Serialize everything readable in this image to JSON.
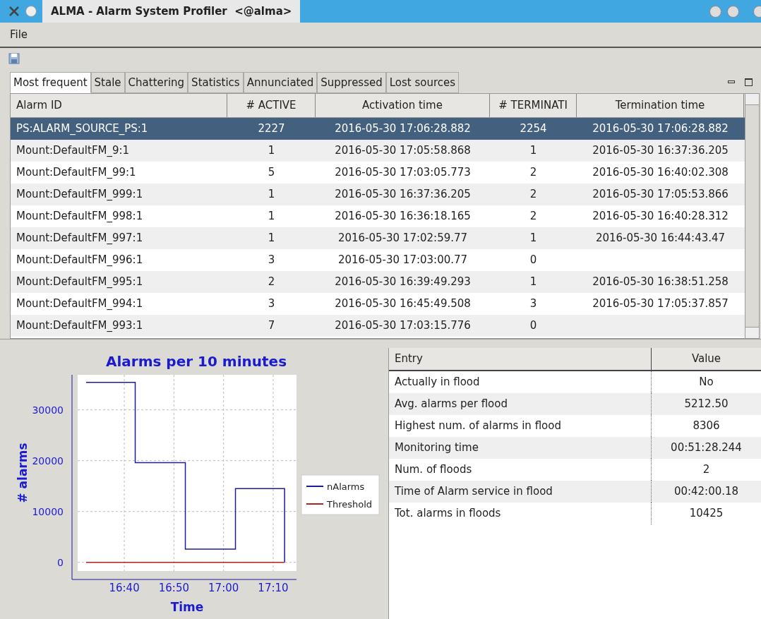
{
  "window": {
    "title": "ALMA - Alarm System Profiler  <@alma>"
  },
  "menu": [
    "File"
  ],
  "tabs": [
    {
      "label": "Most frequent",
      "selected": true
    },
    {
      "label": "Stale",
      "selected": false
    },
    {
      "label": "Chattering",
      "selected": false
    },
    {
      "label": "Statistics",
      "selected": false
    },
    {
      "label": "Annunciated",
      "selected": false
    },
    {
      "label": "Suppressed",
      "selected": false
    },
    {
      "label": "Lost sources",
      "selected": false
    }
  ],
  "table": {
    "columns": [
      "Alarm ID",
      "# ACTIVE",
      "Activation time",
      "# TERMINATI",
      "Termination time"
    ],
    "rows": [
      {
        "selected": true,
        "cells": [
          "PS:ALARM_SOURCE_PS:1",
          "2227",
          "2016-05-30 17:06:28.882",
          "2254",
          "2016-05-30 17:06:28.882"
        ]
      },
      {
        "selected": false,
        "cells": [
          "Mount:DefaultFM_9:1",
          "1",
          "2016-05-30 17:05:58.868",
          "1",
          "2016-05-30 16:37:36.205"
        ]
      },
      {
        "selected": false,
        "cells": [
          "Mount:DefaultFM_99:1",
          "5",
          "2016-05-30 17:03:05.773",
          "2",
          "2016-05-30 16:40:02.308"
        ]
      },
      {
        "selected": false,
        "cells": [
          "Mount:DefaultFM_999:1",
          "1",
          "2016-05-30 16:37:36.205",
          "2",
          "2016-05-30 17:05:53.866"
        ]
      },
      {
        "selected": false,
        "cells": [
          "Mount:DefaultFM_998:1",
          "1",
          "2016-05-30 16:36:18.165",
          "2",
          "2016-05-30 16:40:28.312"
        ]
      },
      {
        "selected": false,
        "cells": [
          "Mount:DefaultFM_997:1",
          "1",
          "2016-05-30 17:02:59.77",
          "1",
          "2016-05-30 16:44:43.47"
        ]
      },
      {
        "selected": false,
        "cells": [
          "Mount:DefaultFM_996:1",
          "3",
          "2016-05-30 17:03:00.77",
          "0",
          ""
        ]
      },
      {
        "selected": false,
        "cells": [
          "Mount:DefaultFM_995:1",
          "2",
          "2016-05-30 16:39:49.293",
          "1",
          "2016-05-30 16:38:51.258"
        ]
      },
      {
        "selected": false,
        "cells": [
          "Mount:DefaultFM_994:1",
          "3",
          "2016-05-30 16:45:49.508",
          "3",
          "2016-05-30 17:05:37.857"
        ]
      },
      {
        "selected": false,
        "cells": [
          "Mount:DefaultFM_993:1",
          "7",
          "2016-05-30 17:03:15.776",
          "0",
          ""
        ]
      }
    ]
  },
  "chart": {
    "chart_data": {
      "type": "line",
      "title": "Alarms per 10 minutes",
      "xlabel": "Time",
      "ylabel": "# alarms",
      "x": [
        992.3,
        1002.2,
        1002.2,
        1012.3,
        1012.3,
        1022.4,
        1022.4,
        1032.3,
        1032.3
      ],
      "series": [
        {
          "name": "nAlarms",
          "color": "#1c1c9c",
          "values": [
            35400,
            35400,
            19600,
            19600,
            2600,
            2600,
            14500,
            14500,
            0
          ]
        },
        {
          "name": "Threshold",
          "color": "#b22222",
          "values": [
            0,
            0,
            0,
            0,
            0,
            0,
            0,
            0,
            0
          ]
        }
      ],
      "grid": true,
      "legend": "right",
      "xlim": [
        990.6,
        1034.7
      ],
      "ylim": [
        -1700,
        36900
      ],
      "xticks": [
        {
          "value": 1000,
          "label": "16:40"
        },
        {
          "value": 1010,
          "label": "16:50"
        },
        {
          "value": 1020,
          "label": "17:00"
        },
        {
          "value": 1030,
          "label": "17:10"
        }
      ],
      "yticks": [
        0,
        10000,
        20000,
        30000
      ]
    }
  },
  "stats": {
    "columns": [
      "Entry",
      "Value"
    ],
    "rows": [
      [
        "Actually in flood",
        "No"
      ],
      [
        "Avg. alarms per flood",
        "5212.50"
      ],
      [
        "Highest num. of alarms in flood",
        "8306"
      ],
      [
        "Monitoring time",
        "00:51:28.244"
      ],
      [
        "Num. of floods",
        "2"
      ],
      [
        "Time of Alarm service in flood",
        "00:42:00.18"
      ],
      [
        "Tot. alarms in floods",
        "10425"
      ]
    ]
  }
}
